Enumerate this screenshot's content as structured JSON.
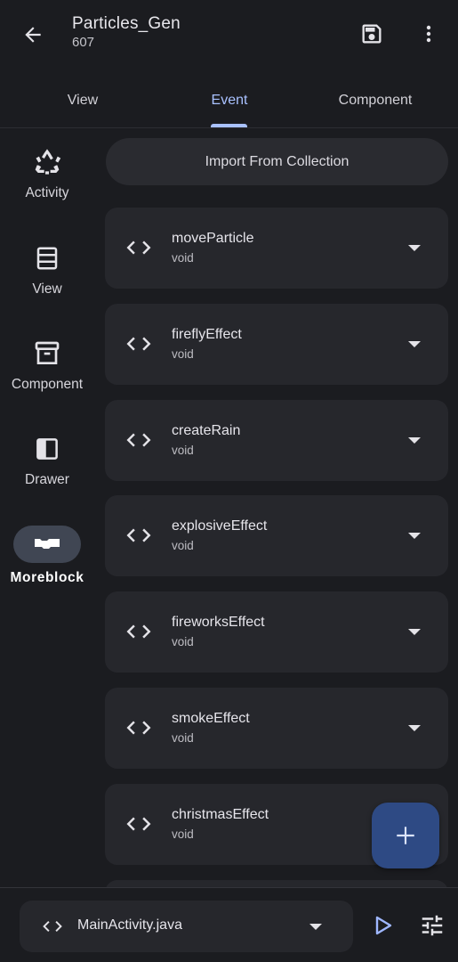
{
  "header": {
    "title": "Particles_Gen",
    "subtitle": "607",
    "back_icon": "arrow-left-icon",
    "save_icon": "save-icon",
    "more_icon": "more-vert-icon"
  },
  "tabs": [
    {
      "label": "View",
      "selected": false
    },
    {
      "label": "Event",
      "selected": true
    },
    {
      "label": "Component",
      "selected": false
    }
  ],
  "rail": {
    "items": [
      {
        "label": "Activity",
        "icon": "recycle-icon"
      },
      {
        "label": "View",
        "icon": "view-list-icon"
      },
      {
        "label": "Component",
        "icon": "archive-box-icon"
      },
      {
        "label": "Drawer",
        "icon": "drawer-panel-icon"
      },
      {
        "label": "Moreblock",
        "icon": "moreblock-icon",
        "selected": true
      }
    ]
  },
  "import_button": {
    "label": "Import From Collection"
  },
  "events": [
    {
      "name": "moveParticle",
      "type": "void"
    },
    {
      "name": "fireflyEffect",
      "type": "void"
    },
    {
      "name": "createRain",
      "type": "void"
    },
    {
      "name": "explosiveEffect",
      "type": "void"
    },
    {
      "name": "fireworksEffect",
      "type": "void"
    },
    {
      "name": "smokeEffect",
      "type": "void"
    },
    {
      "name": "christmasEffect",
      "type": "void"
    }
  ],
  "fab": {
    "icon": "plus-icon"
  },
  "bottom_bar": {
    "file": "MainActivity.java",
    "run_icon": "play-icon",
    "settings_icon": "tune-icon"
  },
  "colors": {
    "background": "#1b1c20",
    "surface": "#26272c",
    "accent": "#a9c1ff",
    "fab": "#2e4a84",
    "rail_selected": "#404653"
  }
}
